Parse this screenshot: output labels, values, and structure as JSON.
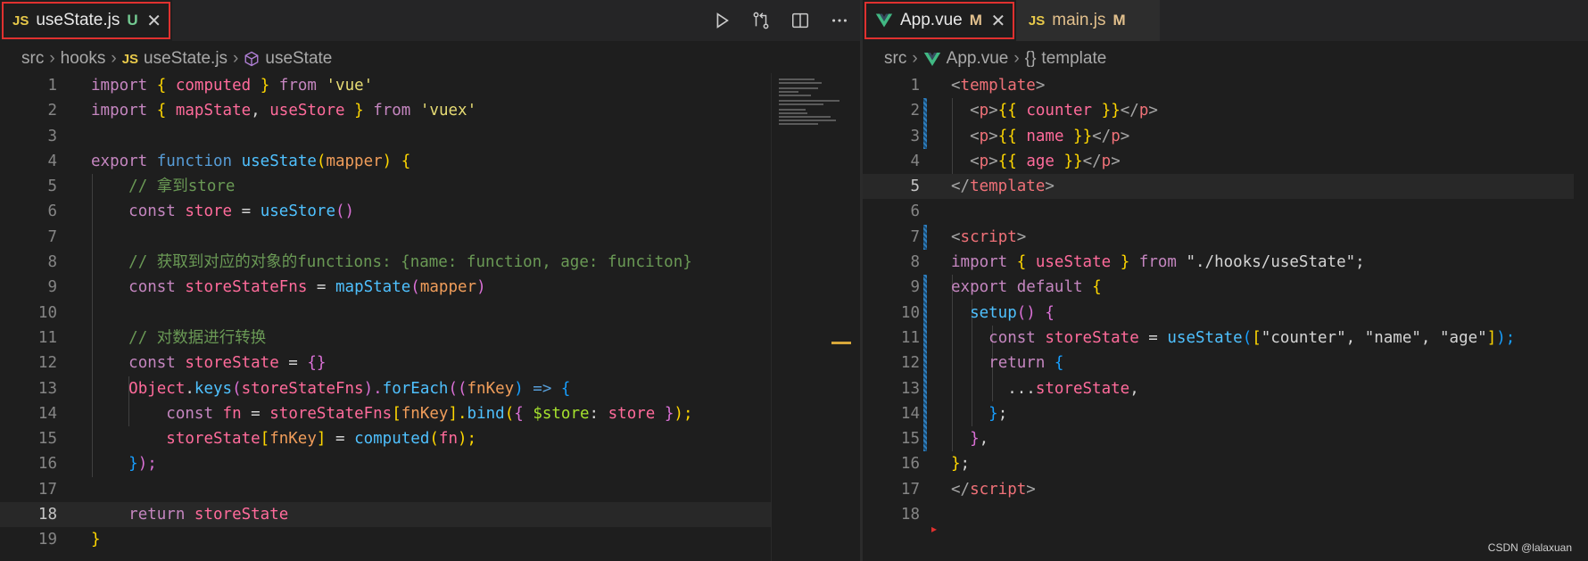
{
  "left_editor": {
    "tab": {
      "lang_badge": "JS",
      "filename": "useState.js",
      "status": "U",
      "close": "✕"
    },
    "breadcrumb": {
      "folder1": "src",
      "folder2": "hooks",
      "lang_badge": "JS",
      "file": "useState.js",
      "symbol": "useState"
    },
    "actions": [
      "run-icon",
      "compare-changes-icon",
      "split-editor-icon",
      "more-actions-icon"
    ],
    "lines": [
      "1",
      "2",
      "3",
      "4",
      "5",
      "6",
      "7",
      "8",
      "9",
      "10",
      "11",
      "12",
      "13",
      "14",
      "15",
      "16",
      "17",
      "18",
      "19"
    ],
    "current_line": "18",
    "code": {
      "l1": [
        "import",
        "{",
        "computed",
        "}",
        "from",
        "'vue'"
      ],
      "l2": [
        "import",
        "{",
        "mapState",
        ",",
        "useStore",
        "}",
        "from",
        "'vuex'"
      ],
      "l4": [
        "export",
        "function",
        "useState",
        "(",
        "mapper",
        ")",
        "{"
      ],
      "l5": "// 拿到store",
      "l6": [
        "const",
        "store",
        "=",
        "useStore",
        "()"
      ],
      "l8": "// 获取到对应的对象的functions: {name: function, age: funciton}",
      "l9": [
        "const",
        "storeStateFns",
        "=",
        "mapState",
        "(",
        "mapper",
        ")"
      ],
      "l11": "// 对数据进行转换",
      "l12": [
        "const",
        "storeState",
        "=",
        "{}"
      ],
      "l13": [
        "Object",
        ".",
        "keys",
        "(",
        "storeStateFns",
        ").",
        "forEach",
        "((",
        "fnKey",
        ")",
        "=>",
        "{"
      ],
      "l14": [
        "const",
        "fn",
        "=",
        "storeStateFns",
        "[",
        "fnKey",
        "].",
        "bind",
        "(",
        "{",
        "$store",
        ":",
        "store",
        "}",
        ");"
      ],
      "l15": [
        "storeState",
        "[",
        "fnKey",
        "]",
        "=",
        "computed",
        "(",
        "fn",
        ");"
      ],
      "l16": [
        "}",
        ");"
      ],
      "l18": [
        "return",
        "storeState"
      ],
      "l19": "}"
    }
  },
  "right_editor": {
    "tabs": [
      {
        "lang": "vue",
        "filename": "App.vue",
        "status": "M",
        "close": "✕"
      },
      {
        "lang_badge": "JS",
        "filename": "main.js",
        "status": "M"
      }
    ],
    "breadcrumb": {
      "folder1": "src",
      "file": "App.vue",
      "symbol_glyph": "{}",
      "symbol": "template"
    },
    "lines": [
      "1",
      "2",
      "3",
      "4",
      "5",
      "6",
      "7",
      "8",
      "9",
      "10",
      "11",
      "12",
      "13",
      "14",
      "15",
      "16",
      "17",
      "18"
    ],
    "current_line": "5",
    "code": {
      "l1": [
        "<",
        "template",
        ">"
      ],
      "l2": [
        "<",
        "p",
        ">",
        "{{",
        "counter",
        "}}",
        "</",
        "p",
        ">"
      ],
      "l3": [
        "<",
        "p",
        ">",
        "{{",
        "name",
        "}}",
        "</",
        "p",
        ">"
      ],
      "l4": [
        "<",
        "p",
        ">",
        "{{",
        "age",
        "}}",
        "</",
        "p",
        ">"
      ],
      "l5": [
        "</",
        "template",
        ">"
      ],
      "l7": [
        "<",
        "script",
        ">"
      ],
      "l8": [
        "import",
        "{",
        "useState",
        "}",
        "from",
        "\"./hooks/useState\"",
        ";"
      ],
      "l9": [
        "export",
        "default",
        "{"
      ],
      "l10": [
        "setup",
        "()",
        "{"
      ],
      "l11": [
        "const",
        "storeState",
        "=",
        "useState",
        "(",
        "[",
        "\"counter\"",
        ",",
        "\"name\"",
        ",",
        "\"age\"",
        "]",
        ");"
      ],
      "l12": [
        "return",
        "{"
      ],
      "l13": [
        "...",
        "storeState",
        ","
      ],
      "l14": [
        "}",
        ";"
      ],
      "l15": [
        "}",
        ","
      ],
      "l16": [
        "}",
        ";"
      ],
      "l17": [
        "</",
        "script",
        ">"
      ]
    }
  },
  "watermark": "CSDN @lalaxuan",
  "colors": {
    "accent_red": "#e0312f",
    "js_badge": "#e8c94a",
    "untracked": "#73c991",
    "modified": "#e2c08d"
  }
}
